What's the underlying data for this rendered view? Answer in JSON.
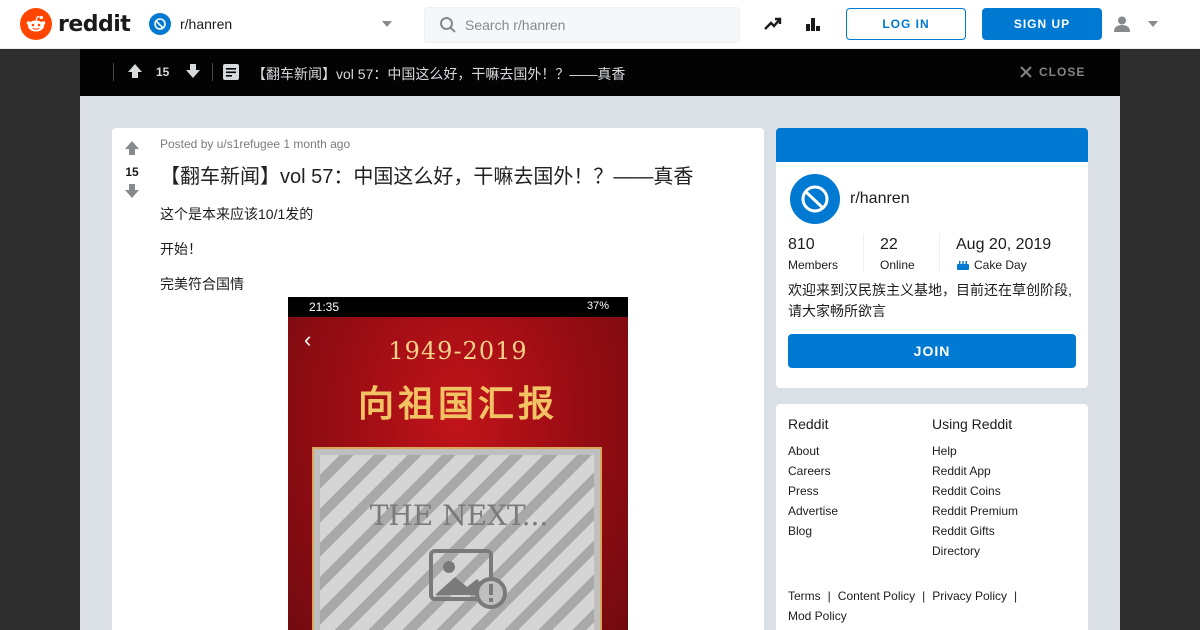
{
  "nav": {
    "logo_text": "reddit",
    "community": "r/hanren",
    "search_placeholder": "Search r/hanren",
    "login_label": "LOG IN",
    "signup_label": "SIGN UP"
  },
  "postbar": {
    "score": "15",
    "title": "【翻车新闻】vol 57：中国这么好，干嘛去国外！？——真香",
    "close_label": "CLOSE"
  },
  "post": {
    "score": "15",
    "meta": "Posted by u/s1refugee 1 month ago",
    "title": "【翻车新闻】vol 57：中国这么好，干嘛去国外！？——真香",
    "paragraphs": [
      "这个是本来应该10/1发的",
      "开始！",
      "完美符合国情"
    ],
    "image": {
      "status_time": "21:35",
      "status_battery": "37%",
      "years": "1949-2019",
      "headline": "向祖国汇报",
      "placeholder": "THE NEXT..."
    }
  },
  "about": {
    "name": "r/hanren",
    "members_value": "810",
    "members_label": "Members",
    "online_value": "22",
    "online_label": "Online",
    "cake_value": "Aug 20, 2019",
    "cake_label": "Cake Day",
    "description": "欢迎来到汉民族主义基地，目前还在草创阶段,请大家畅所欲言",
    "join_label": "JOIN"
  },
  "footer": {
    "col1_title": "Reddit",
    "col1_links": [
      "About",
      "Careers",
      "Press",
      "Advertise",
      "Blog"
    ],
    "col2_title": "Using Reddit",
    "col2_links": [
      "Help",
      "Reddit App",
      "Reddit Coins",
      "Reddit Premium",
      "Reddit Gifts",
      "Directory"
    ],
    "bottom_links": [
      "Terms",
      "Content Policy",
      "Privacy Policy",
      "Mod Policy"
    ]
  },
  "colors": {
    "brand": "#ff4500",
    "accent": "#0079d3",
    "postbar_bg": "#030303",
    "page_bg": "#dae0e6"
  }
}
